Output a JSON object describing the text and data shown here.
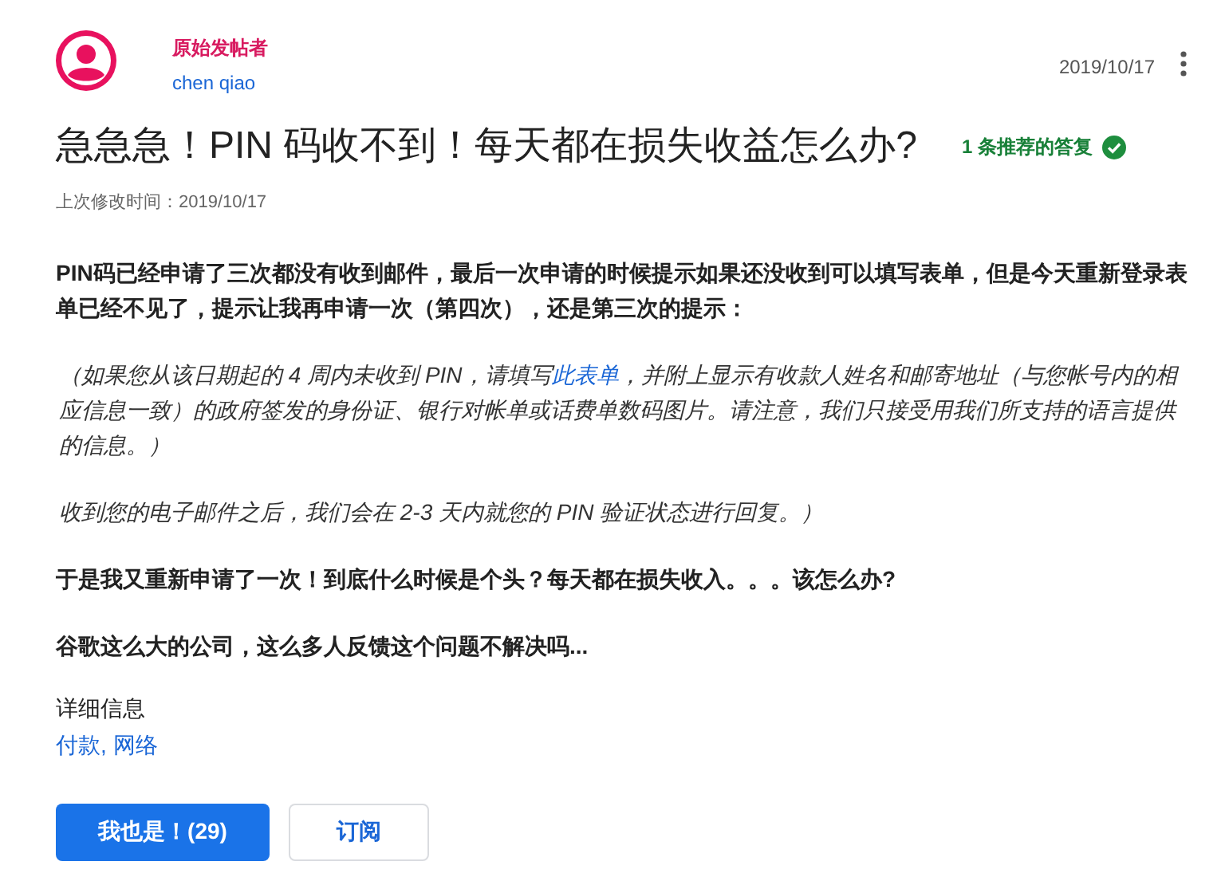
{
  "author": {
    "role": "原始发帖者",
    "name": "chen qiao",
    "date": "2019/10/17"
  },
  "title": "急急急！PIN 码收不到！每天都在损失收益怎么办?",
  "recommended": {
    "label": "1 条推荐的答复",
    "verified": true
  },
  "modified": "上次修改时间：2019/10/17",
  "paragraphs": [
    {
      "kind": "bold",
      "parts": [
        {
          "text": "PIN码已经申请了三次都没有收到邮件，最后一次申请的时候提示如果还没收到可以填写表单，但是今天重新登录表单已经不见了，提示让我再申请一次（第四次），还是第三次的提示："
        }
      ]
    },
    {
      "kind": "italic",
      "parts": [
        {
          "text": "（如果您从该日期起的 4 周内未收到 PIN，请填写"
        },
        {
          "link": "此表单"
        },
        {
          "text": "，并附上显示有收款人姓名和邮寄地址（与您帐号内的相应信息一致）的政府签发的身份证、银行对帐单或话费单数码图片。请注意，我们只接受用我们所支持的语言提供的信息。）"
        }
      ]
    },
    {
      "kind": "italic",
      "parts": [
        {
          "text": "收到您的电子邮件之后，我们会在 2-3 天内就您的 PIN 验证状态进行回复。）"
        }
      ]
    },
    {
      "kind": "bold",
      "parts": [
        {
          "text": "于是我又重新申请了一次！到底什么时候是个头？每天都在损失收入。。。该怎么办?"
        }
      ]
    },
    {
      "kind": "bold",
      "parts": [
        {
          "text": "谷歌这么大的公司，这么多人反馈这个问题不解决吗..."
        }
      ]
    }
  ],
  "details": {
    "heading": "详细信息",
    "tags": [
      {
        "label": "付款,"
      },
      {
        "label": "网络"
      }
    ]
  },
  "buttons": [
    {
      "label": "我也是！(29)",
      "kind": "primary"
    },
    {
      "label": "订阅",
      "kind": "secondary"
    }
  ]
}
